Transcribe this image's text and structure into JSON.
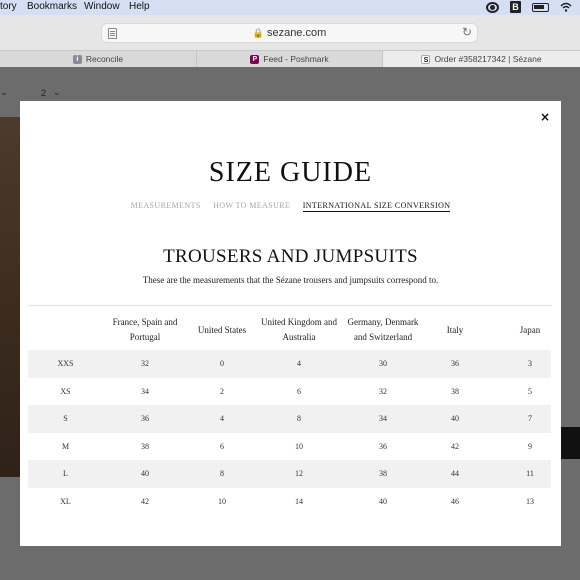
{
  "menubar": {
    "items": [
      "tory",
      "Bookmarks",
      "Window",
      "Help"
    ]
  },
  "browser": {
    "url": "sezane.com",
    "tabs": [
      {
        "label": "Reconcile",
        "favicon": "i"
      },
      {
        "label": "Feed - Poshmark",
        "favicon": "P"
      },
      {
        "label": "Order #358217342 | Sézane",
        "favicon": "S"
      }
    ]
  },
  "background": {
    "quantity": "2"
  },
  "modal": {
    "close_label": "×",
    "title": "SIZE GUIDE",
    "tabs": [
      {
        "label": "MEASUREMENTS",
        "active": false
      },
      {
        "label": "HOW TO MEASURE",
        "active": false
      },
      {
        "label": "INTERNATIONAL SIZE CONVERSION",
        "active": true
      }
    ],
    "section_title": "TROUSERS AND JUMPSUITS",
    "description": "These are the measurements that the Sézane trousers and jumpsuits correspond to.",
    "table": {
      "headers": [
        "",
        "France, Spain and Portugal",
        "United States",
        "United Kingdom and Australia",
        "Germany, Denmark and Switzerland",
        "Italy",
        "Japan"
      ],
      "rows": [
        [
          "XXS",
          "32",
          "0",
          "4",
          "30",
          "36",
          "3"
        ],
        [
          "XS",
          "34",
          "2",
          "6",
          "32",
          "38",
          "5"
        ],
        [
          "S",
          "36",
          "4",
          "8",
          "34",
          "40",
          "7"
        ],
        [
          "M",
          "38",
          "6",
          "10",
          "36",
          "42",
          "9"
        ],
        [
          "L",
          "40",
          "8",
          "12",
          "38",
          "44",
          "11"
        ],
        [
          "XL",
          "42",
          "10",
          "14",
          "40",
          "46",
          "13"
        ]
      ]
    }
  },
  "colors": {
    "menubar": "#d5dff4",
    "overlay": "#6c6c6c",
    "row_shade": "#f1f1f1",
    "poshmark": "#7f0353"
  }
}
